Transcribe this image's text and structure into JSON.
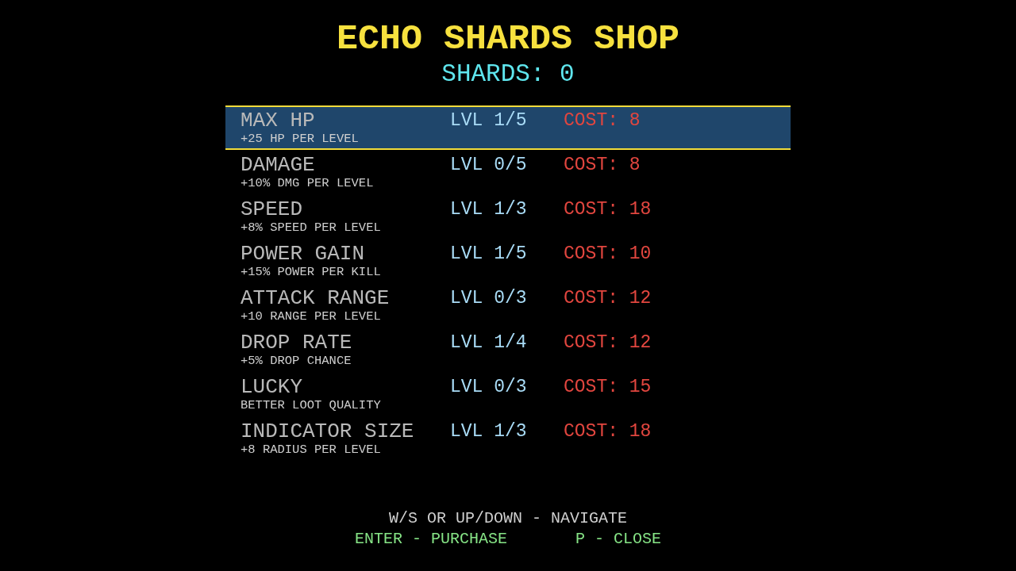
{
  "title": "ECHO SHARDS SHOP",
  "shards": "SHARDS: 0",
  "upgrades": [
    {
      "name": "MAX HP",
      "description": "+25 HP PER LEVEL",
      "rank": "LVL 1/5",
      "cost": "COST: 8",
      "selected": true
    },
    {
      "name": "DAMAGE",
      "description": "+10% DMG PER LEVEL",
      "rank": "LVL 0/5",
      "cost": "COST: 8",
      "selected": false
    },
    {
      "name": "SPEED",
      "description": "+8% SPEED PER LEVEL",
      "rank": "LVL 1/3",
      "cost": "COST: 18",
      "selected": false
    },
    {
      "name": "POWER GAIN",
      "description": "+15% POWER PER KILL",
      "rank": "LVL 1/5",
      "cost": "COST: 10",
      "selected": false
    },
    {
      "name": "ATTACK RANGE",
      "description": "+10 RANGE PER LEVEL",
      "rank": "LVL 0/3",
      "cost": "COST: 12",
      "selected": false
    },
    {
      "name": "DROP RATE",
      "description": "+5% DROP CHANCE",
      "rank": "LVL 1/4",
      "cost": "COST: 12",
      "selected": false
    },
    {
      "name": "LUCKY",
      "description": "BETTER LOOT QUALITY",
      "rank": "LVL 0/3",
      "cost": "COST: 15",
      "selected": false
    },
    {
      "name": "INDICATOR SIZE",
      "description": "+8 RADIUS PER LEVEL",
      "rank": "LVL 1/3",
      "cost": "COST: 18",
      "selected": false
    }
  ],
  "controls": {
    "navigate": "W/S OR UP/DOWN - NAVIGATE",
    "purchase": "ENTER - PURCHASE",
    "close": "P - CLOSE"
  }
}
